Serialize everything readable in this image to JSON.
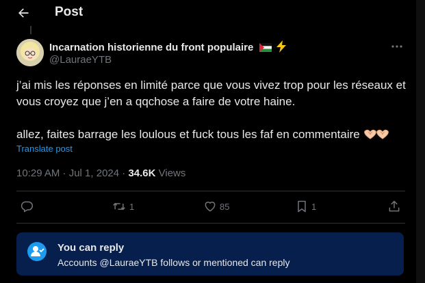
{
  "header": {
    "title": "Post",
    "back_icon": "arrow-left-icon"
  },
  "post": {
    "author_name": "Incarnation historienne du front populaire",
    "author_handle": "@LauraeYTB",
    "name_emojis": [
      "palestine-flag-icon",
      "lightning-icon"
    ],
    "paragraph1": "j’ai mis les réponses en limité parce que vous vivez trop pour les réseaux et vous croyez que j’en a qqchose a faire de votre haine.",
    "paragraph2": "allez, faites barrage les loulous et fuck tous les faf en commentaire",
    "paragraph2_emoji": "heart-hands-icon",
    "translate_label": "Translate post",
    "time": "10:29 AM · Jul 1, 2024 · ",
    "views_count": "34.6K",
    "views_label": " Views"
  },
  "actions": {
    "reply_count": "",
    "repost_count": "1",
    "like_count": "85",
    "bookmark_count": "1"
  },
  "reply_restriction": {
    "title": "You can reply",
    "subtitle": "Accounts @LauraeYTB follows or mentioned can reply"
  },
  "colors": {
    "accent": "#1d9bf0",
    "muted": "#71767b",
    "background": "#000000",
    "reply_box": "#061f4d"
  }
}
